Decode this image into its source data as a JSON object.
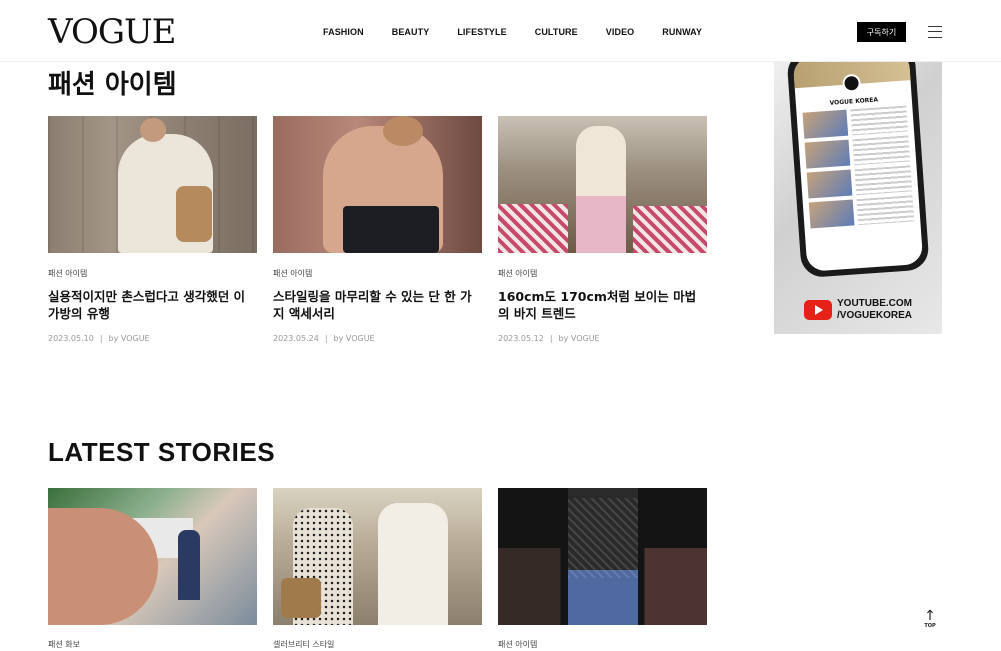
{
  "header": {
    "logo": "VOGUE",
    "nav": [
      "FASHION",
      "BEAUTY",
      "LIFESTYLE",
      "CULTURE",
      "VIDEO",
      "RUNWAY"
    ],
    "subscribe_label": "구독하기",
    "menu_icon": "hamburger-menu-icon"
  },
  "section1": {
    "title": "패션 아이템",
    "articles": [
      {
        "category": "패션 아이템",
        "headline": "실용적이지만 촌스럽다고 생각했던 이 가방의 유행",
        "date": "2023.05.10",
        "byline": "by VOGUE"
      },
      {
        "category": "패션 아이템",
        "headline": "스타일링을 마무리할 수 있는 단 한 가지 액세서리",
        "date": "2023.05.24",
        "byline": "by VOGUE"
      },
      {
        "category": "패션 아이템",
        "headline": "160cm도 170cm처럼 보이는 마법의 바지 트렌드",
        "date": "2023.05.12",
        "byline": "by VOGUE"
      }
    ]
  },
  "ad": {
    "brand": "VOGUE KOREA",
    "youtube_line1": "YOUTUBE.COM",
    "youtube_line2": "/VOGUEKOREA"
  },
  "section2": {
    "title": "LATEST STORIES",
    "articles": [
      {
        "category": "패션 화보"
      },
      {
        "category": "셀러브리티 스타일"
      },
      {
        "category": "패션 아이템"
      }
    ]
  },
  "top_button": {
    "label": "TOP"
  }
}
